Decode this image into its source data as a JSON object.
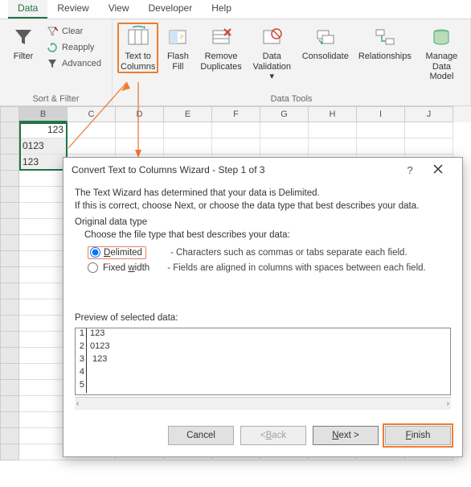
{
  "tabs": {
    "active": "Data",
    "items": [
      "Data",
      "Review",
      "View",
      "Developer",
      "Help"
    ]
  },
  "ribbon": {
    "sortfilter": {
      "label": "Sort & Filter",
      "filter": "Filter",
      "clear": "Clear",
      "reapply": "Reapply",
      "advanced": "Advanced"
    },
    "datatools": {
      "label": "Data Tools",
      "text_to_columns": "Text to\nColumns",
      "flash_fill": "Flash\nFill",
      "remove_duplicates": "Remove\nDuplicates",
      "data_validation": "Data\nValidation",
      "consolidate": "Consolidate",
      "relationships": "Relationships",
      "manage_data_model": "Manage\nData Model"
    }
  },
  "sheet": {
    "columns": [
      "B",
      "C",
      "D",
      "E",
      "F",
      "G",
      "H",
      "I",
      "J"
    ],
    "rows": [
      {
        "b": "123",
        "b_align": "right"
      },
      {
        "b": "0123",
        "b_align": "left"
      },
      {
        "b": " 123",
        "b_align": "left"
      }
    ]
  },
  "dialog": {
    "title": "Convert Text to Columns Wizard - Step 1 of 3",
    "line1": "The Text Wizard has determined that your data is Delimited.",
    "line2": "If this is correct, choose Next, or choose the data type that best describes your data.",
    "original_label": "Original data type",
    "choose_label": "Choose the file type that best describes your data:",
    "delimited_label": "Delimited",
    "delimited_desc": "- Characters such as commas or tabs separate each field.",
    "fixed_label": "Fixed width",
    "fixed_desc": "- Fields are aligned in columns with spaces between each field.",
    "preview_label": "Preview of selected data:",
    "preview_rows": [
      "123",
      "0123",
      " 123",
      "",
      ""
    ],
    "buttons": {
      "cancel": "Cancel",
      "back": "< Back",
      "next": "Next >",
      "finish": "Finish"
    }
  }
}
